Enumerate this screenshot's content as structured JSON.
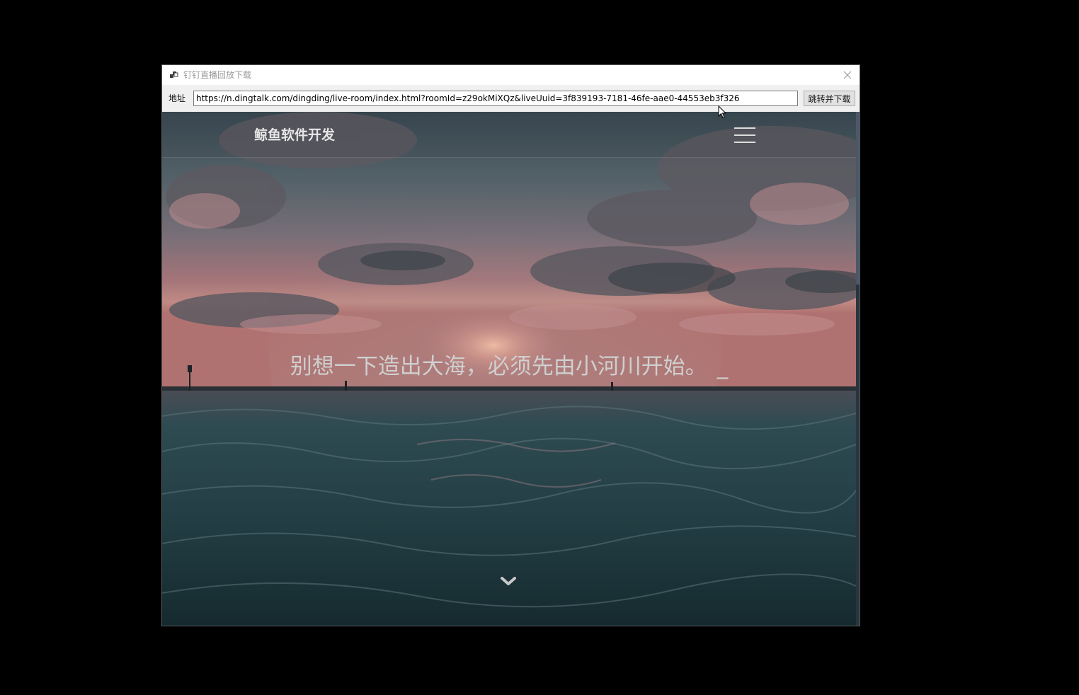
{
  "window": {
    "title": "钉钉直播回放下载"
  },
  "toolbar": {
    "address_label": "地址",
    "address_value": "https://n.dingtalk.com/dingding/live-room/index.html?roomId=z29okMiXQz&liveUuid=3f839193-7181-46fe-aae0-44553eb3f326",
    "go_button_label": "跳转并下载"
  },
  "page": {
    "brand": "鲸鱼软件开发",
    "hero_text": "别想一下造出大海，必须先由小河川开始。",
    "typing_cursor": "_"
  },
  "colors": {
    "sky_top": "#3f5159",
    "sky_mid": "#6e6a75",
    "horizon": "#b8787a",
    "sea": "#1f3a3e"
  },
  "icons": {
    "app": "app-window-icon",
    "close": "close-icon",
    "menu": "hamburger-menu-icon",
    "scroll": "chevron-down-icon"
  }
}
